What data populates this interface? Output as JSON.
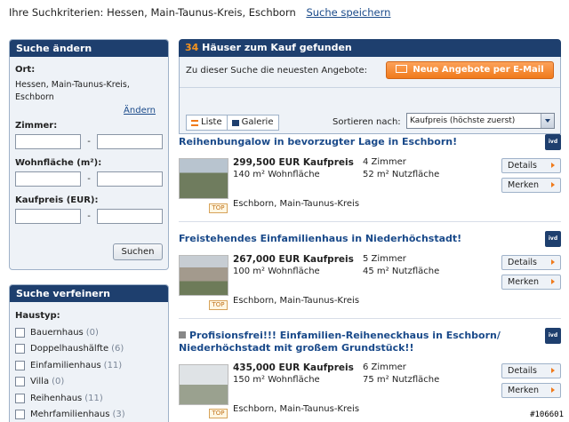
{
  "top": {
    "criteria": "Ihre Suchkriterien: Hessen, Main-Taunus-Kreis, Eschborn",
    "save_link": "Suche speichern"
  },
  "sidebar": {
    "change_title": "Suche ändern",
    "ort_label": "Ort:",
    "ort_value": "Hessen, Main-Taunus-Kreis, Eschborn",
    "aendern_link": "Ändern",
    "zimmer_label": "Zimmer:",
    "flaeche_label": "Wohnfläche (m²):",
    "preis_label": "Kaufpreis (EUR):",
    "range_dash": "-",
    "search_button": "Suchen",
    "refine_title": "Suche verfeinern",
    "haustyp_label": "Haustyp:",
    "haustyp_items": [
      {
        "label": "Bauernhaus",
        "count": "(0)"
      },
      {
        "label": "Doppelhaushälfte",
        "count": "(6)"
      },
      {
        "label": "Einfamilienhaus",
        "count": "(11)"
      },
      {
        "label": "Villa",
        "count": "(0)"
      },
      {
        "label": "Reihenhaus",
        "count": "(11)"
      },
      {
        "label": "Mehrfamilienhaus",
        "count": "(3)"
      }
    ]
  },
  "results": {
    "count": "34",
    "title": "Häuser zum Kauf gefunden",
    "newest_text": "Zu dieser Suche die neuesten Angebote:",
    "email_button": "Neue Angebote per E-Mail",
    "view_list": "Liste",
    "view_gallery": "Galerie",
    "sort_label": "Sortieren nach:",
    "sort_value": "Kaufpreis (höchste zuerst)"
  },
  "listings": [
    {
      "title": "Reihenbungalow in bevorzugter Lage in Eschborn!",
      "price": "299,500 EUR Kaufpreis",
      "rooms": "4 Zimmer",
      "living": "140 m² Wohnfläche",
      "usable": "52 m² Nutzfläche",
      "city": "Eschborn, Main-Taunus-Kreis"
    },
    {
      "title": "Freistehendes Einfamilienhaus in Niederhöchstadt!",
      "price": "267,000 EUR Kaufpreis",
      "rooms": "5 Zimmer",
      "living": "100 m² Wohnfläche",
      "usable": "45 m² Nutzfläche",
      "city": "Eschborn, Main-Taunus-Kreis"
    },
    {
      "title": "Profisionsfrei!!! Einfamilien-Reiheneckhaus in Eschborn/ Niederhöchstadt mit großem Grundstück!!",
      "price": "435,000 EUR Kaufpreis",
      "rooms": "6 Zimmer",
      "living": "150 m² Wohnfläche",
      "usable": "75 m² Nutzfläche",
      "city": "Eschborn, Main-Taunus-Kreis"
    }
  ],
  "labels": {
    "details": "Details",
    "merken": "Merken",
    "top": "TOP",
    "ivd": "ivd"
  },
  "watermark": "#106601"
}
